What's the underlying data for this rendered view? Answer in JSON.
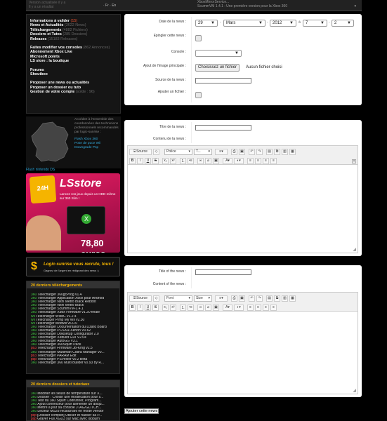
{
  "topstrip": {
    "left_line1": "Version actualisée il y a",
    "left_line2": "Il y a un résultat",
    "lang": "· Fr · En",
    "news_line1": "XboxMirrorService...",
    "news_line2": "ScummVM 1.4.1 : Une première version pour la Xbox 360",
    "arrow": "▾"
  },
  "sidebar": {
    "group1": [
      {
        "label": "Informations à valider",
        "count": "(15)",
        "count_red": true
      },
      {
        "label": "News et Actualités",
        "count": "(3622 News)"
      },
      {
        "label": "Téléchargements",
        "count": "(4882 Fichiers)"
      },
      {
        "label": "Dossiers et Tutos",
        "count": "(285 Dossiers)"
      },
      {
        "label": "Releases",
        "count": "(15183 Releases)"
      }
    ],
    "group2": [
      {
        "label": "Faites modifier vos consoles",
        "count": "(862 Annonces)"
      },
      {
        "label": "Abonnement Xbox Live",
        "count": ""
      },
      {
        "label": "Microsoft points",
        "count": ""
      },
      {
        "label": "LS store : la boutique",
        "count": ""
      }
    ],
    "group3": [
      {
        "label": "Forums",
        "count": ""
      },
      {
        "label": "Shoutbox",
        "count": ""
      }
    ],
    "group4": [
      {
        "label": "Proposer une news ou actualités",
        "count": ""
      },
      {
        "label": "Proposer un dossier ou tuto",
        "count": ""
      },
      {
        "label": "Gestion de votre compte",
        "count": "(solde : 96)"
      }
    ]
  },
  "mapbox": {
    "text": "Accédez à l'ensemble des coordonnées des techniciens professionnels recommandés par logic-sunrise :",
    "links": [
      "Flash Xbox 360",
      "Pose de puce Wii",
      "Downgrade Psp"
    ],
    "bottom": "Flash nintendo DS"
  },
  "lsstore": {
    "badge": "24H",
    "title": "LSstore",
    "tagline": "Lancez vos jeux depuis un HDD même sur 360 Slim !",
    "price": "78,80 euros",
    "xbox_mark": "X"
  },
  "logic_banner": {
    "symbol": "$",
    "title": "Logic-sunrise vous recrute, tous !",
    "sub": "Gagnez de l'argent en rédigeant des news :)"
  },
  "downloads": {
    "title": "20 derniers téléchargements",
    "items": [
      {
        "tag": "360",
        "text": "Télécharger 360gcProg v1.4"
      },
      {
        "tag": "360",
        "text": "Télécharger Application Xbox pour Android"
      },
      {
        "tag": "360",
        "text": "Télécharger Nxhl Metro Black Reboot"
      },
      {
        "tag": "360",
        "text": "Télécharger Nxhl Metro Black"
      },
      {
        "tag": "360",
        "text": "Télécharger ScummVM-1.4.1"
      },
      {
        "tag": "360",
        "text": "Télécharger Xbox Firmware v1.20 finale"
      },
      {
        "tag": "wii",
        "text": "Télécharger WiiMC v1.2.4"
      },
      {
        "tag": "wii",
        "text": "Télécharger Pimp My Wii v2.30"
      },
      {
        "tag": "wii",
        "text": "Télécharger ModMii v6.0.0"
      },
      {
        "tag": "360",
        "text": "Télécharger Documentation du Lizard Board"
      },
      {
        "tag": "360",
        "text": "Télécharger PCSXR-Xenon V0.62"
      },
      {
        "tag": "360",
        "text": "Télécharger Disksetup Configurator 2.0"
      },
      {
        "tag": "360",
        "text": "Télécharger Xebuild GUI V2.04"
      },
      {
        "tag": "360",
        "text": "Télécharger AutoGG V3.1"
      },
      {
        "tag": "360",
        "text": "Télécharger 360Squirt Pack"
      },
      {
        "tag": "ps3",
        "text": "Télécharger Firmware JB-King v2.5"
      },
      {
        "tag": "360",
        "text": "Télécharger Multiman Cobra Manager v0..."
      },
      {
        "tag": "ps3",
        "text": "Télécharger PARAM Edit"
      },
      {
        "tag": "psp",
        "text": "Télécharger PSVexler v0.2 Beta"
      },
      {
        "tag": "360",
        "text": "Télécharger 360 Multi Builder v0.93 by R..."
      }
    ]
  },
  "dossiers": {
    "title": "20 derniers dossiers et tutoriaux",
    "items": [
      {
        "tag": "360",
        "text": "Modifier les seuils de température sur X..."
      },
      {
        "tag": "360",
        "text": "Dossier : Choisir une modification pour s..."
      },
      {
        "tag": "360",
        "text": "Test du 360 Squirt Codrunner, Program..."
      },
      {
        "tag": "360",
        "text": "Ajout connecteur pour alimenter un disqu..."
      },
      {
        "tag": "360",
        "text": "Mettre à jour sa console JTAG/GLITCH..."
      },
      {
        "tag": "360",
        "text": "Lecteur MS28 recalcinant en mode vendor"
      },
      {
        "tag": "psp",
        "text": "[Dossier complet] Utiliser et hacker sa P..."
      },
      {
        "tag": "psp",
        "text": "Graver Full XGD3 sur Mac avec Isoburn"
      }
    ]
  },
  "form1": {
    "date_label": "Date de la news :",
    "day": "29",
    "month": "Mars",
    "year": "2012",
    "a": "à",
    "hour": "7",
    "minute": "2",
    "epingler_label": "Epingler cette news :",
    "console_label": "Console :",
    "image_label": "Ajout de l'image principale :",
    "file_button": "Choisissez un fichier",
    "file_none": "Aucun fichier choisi",
    "source_label": "Source de la news :",
    "fichier_label": "Ajouter un fichier :"
  },
  "form2": {
    "title_label": "Titre de la news :",
    "content_label": "Contenu de la news :",
    "source_btn": "Source",
    "font_dd": "Police",
    "size_dd": "T...",
    "bold": "B",
    "italic": "I",
    "underline": "U",
    "strike": "S"
  },
  "form3": {
    "title_label": "Title of the news :",
    "content_label": "Content of the news :",
    "source_btn": "Source",
    "font_dd": "Font",
    "size_dd": "Size",
    "bold": "B",
    "italic": "I",
    "underline": "U",
    "strike": "S"
  },
  "submit_label": "Ajouter cette news"
}
